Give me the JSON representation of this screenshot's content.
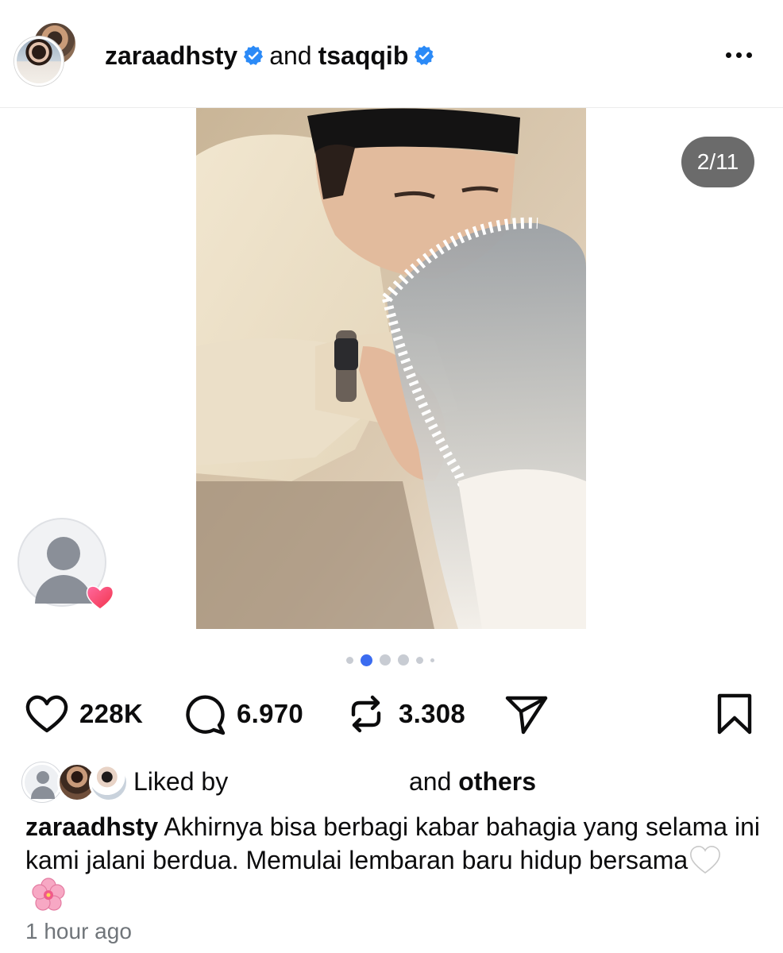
{
  "post": {
    "author_primary": "zaraadhsty",
    "joiner": "and",
    "author_secondary": "tsaqqib",
    "more_icon": "more-horizontal-icon",
    "verified_color": "#2b8af7"
  },
  "media": {
    "counter": "2/11",
    "current_index": 2,
    "total": 11,
    "tag_icon": "person-tag-icon"
  },
  "carousel": {
    "dot_count": 6,
    "active_dot": 1,
    "active_color": "#3b6cf0"
  },
  "actions": {
    "like_count": "228K",
    "comment_count": "6.970",
    "repost_count": "3.308"
  },
  "liked_by": {
    "prefix": "Liked by",
    "suffix": "and",
    "others": "others"
  },
  "caption": {
    "username": "zaraadhsty",
    "text": "Akhirnya bisa berbagi kabar bahagia yang selama ini kami jalani berdua. Memulai lembaran baru hidup bersama"
  },
  "timestamp": "1 hour ago"
}
